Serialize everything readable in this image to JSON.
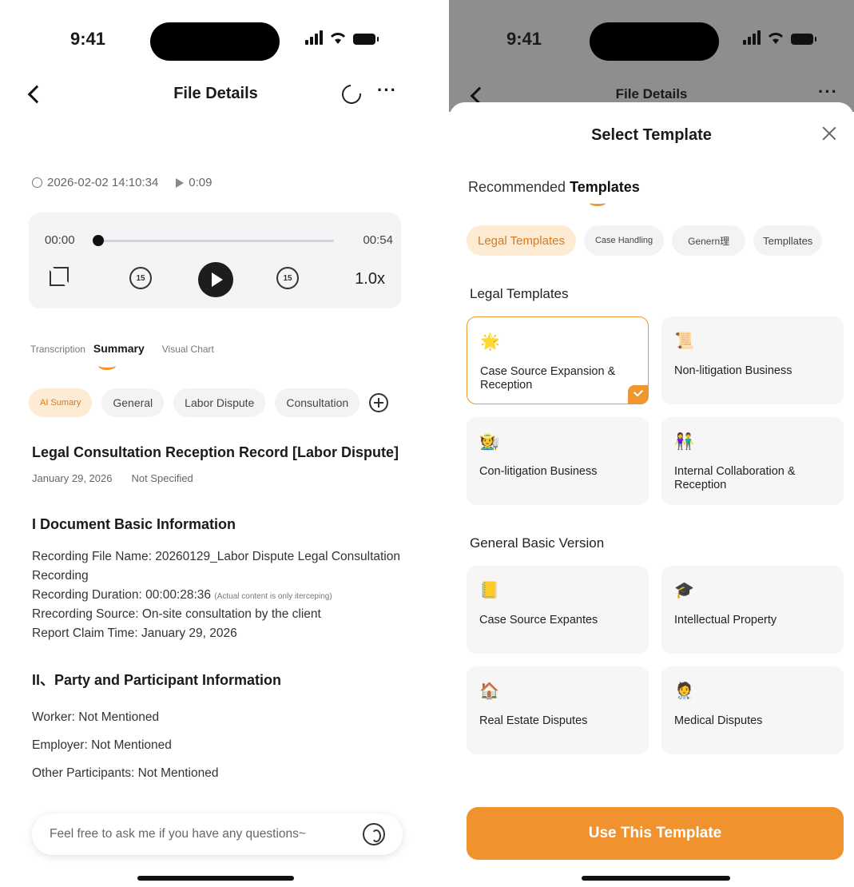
{
  "left": {
    "status": {
      "time": "9:41"
    },
    "header": {
      "title": "File Details",
      "more": "···"
    },
    "meta": {
      "datetime": "2026-02-02 14:10:34",
      "duration": "0:09"
    },
    "player": {
      "current": "00:00",
      "total": "00:54",
      "skip_back": "15",
      "skip_forward": "15",
      "speed": "1.0x",
      "progress": 0
    },
    "tabs": [
      "Transcription",
      "Summary",
      "Visual Chart"
    ],
    "chips": [
      "AI Sumary",
      "General",
      "Labor Dispute",
      "Consultation"
    ],
    "doc": {
      "title": "Legal Consultation Reception Record [Labor Dispute]",
      "date": "January 29, 2026",
      "specified": "Not Specified",
      "sec1_title": "I Document Basic Information",
      "sec1_l1": "Recording File Name: 20260129_Labor Dispute Legal Consultation Recording",
      "sec1_l2": "Recording Duration: 00:00:28:36",
      "sec1_l2_note": "(Actual content is only iterceping)",
      "sec1_l3": "Rrecording Source: On-site consultation by the client",
      "sec1_l4": "Report Claim Time: January 29, 2026",
      "sec2_title": "II、Party and Participant Information",
      "sec2_l1": "Worker: Not Mentioned",
      "sec2_l2": "Employer: Not Mentioned",
      "sec2_l3": "Other Participants: Not Mentioned"
    },
    "ask_placeholder": "Feel free to ask me if you have any questions~"
  },
  "right": {
    "status": {
      "time": "9:41"
    },
    "header": {
      "title": "File Details",
      "more": "···"
    },
    "sheet": {
      "title": "Select Template",
      "recommended_prefix": "Recommended ",
      "recommended_bold": "Templates",
      "chips": [
        "Legal Templates",
        "Case Handling",
        "Genern理",
        "Templlates"
      ],
      "section_legal": "Legal Templates",
      "legal_cards": [
        {
          "icon": "🌟",
          "label": "Case Source Expansion & Reception",
          "selected": true
        },
        {
          "icon": "📜",
          "label": "Non-litigation Business",
          "selected": false
        },
        {
          "icon": "🧑‍🌾",
          "label": "Con-litigation Business",
          "selected": false
        },
        {
          "icon": "👫",
          "label": "Internal Collaboration & Reception",
          "selected": false
        }
      ],
      "section_general": "General Basic Version",
      "general_cards": [
        {
          "icon": "📒",
          "label": "Case Source Expantes"
        },
        {
          "icon": "🎓",
          "label": "Intellectual Property"
        },
        {
          "icon": "🏠",
          "label": "Real Estate Disputes"
        },
        {
          "icon": "🧑‍⚕️",
          "label": "Medical Disputes"
        }
      ],
      "button": "Use This Template"
    }
  },
  "colors": {
    "accent": "#f0922e",
    "accent_soft": "#fdebd4"
  }
}
